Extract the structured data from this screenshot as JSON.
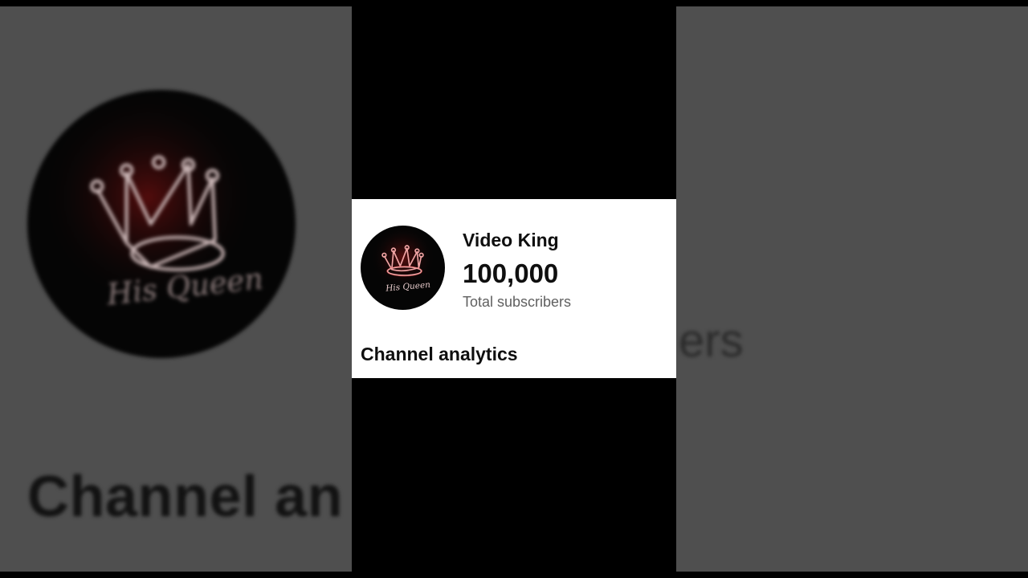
{
  "channel": {
    "name": "Video King",
    "subscriber_count": "100,000",
    "subscriber_label": "Total subscribers",
    "avatar_logo_text": "His Queen",
    "avatar_icon": "crown-icon"
  },
  "section": {
    "title": "Channel analytics"
  },
  "background": {
    "heading_fragment": "Channel an",
    "subscriber_label_fragment": "ers"
  },
  "colors": {
    "card_background": "#ffffff",
    "primary_text": "#0f0f0f",
    "secondary_text": "#606060",
    "avatar_background": "#050505",
    "crown_glow": "#e04a4a",
    "blurred_backdrop": "#4f4f4f"
  }
}
